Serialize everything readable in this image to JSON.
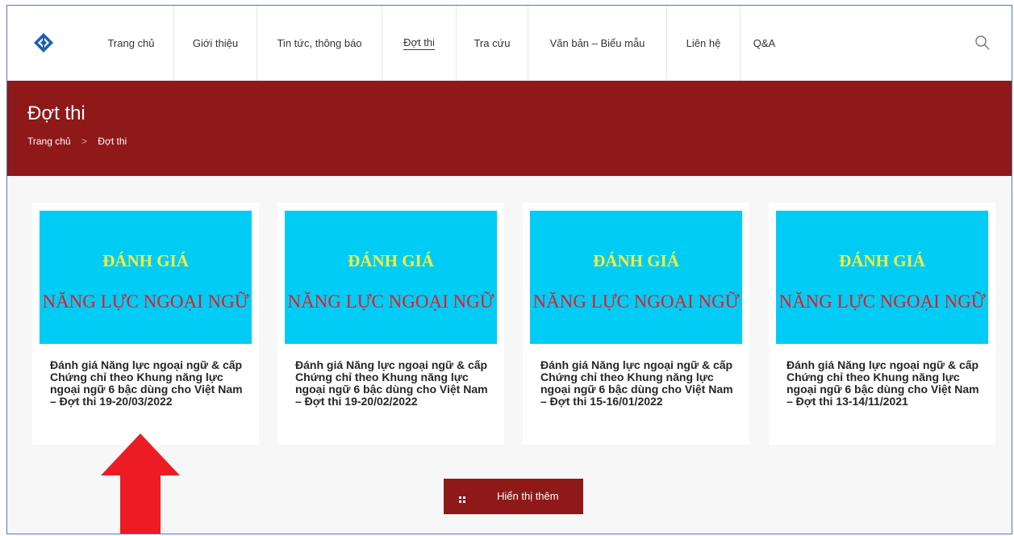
{
  "nav": {
    "items": [
      {
        "label": "Trang chủ"
      },
      {
        "label": "Giới thiệu"
      },
      {
        "label": "Tin tức, thông báo"
      },
      {
        "label": "Đợt thi"
      },
      {
        "label": "Tra cứu"
      },
      {
        "label": "Văn bản – Biểu mẫu"
      },
      {
        "label": "Liên hệ"
      },
      {
        "label": "Q&A"
      }
    ],
    "active_index": 3,
    "search_icon": "search-icon"
  },
  "banner": {
    "title": "Đợt thi",
    "breadcrumb": {
      "home": "Trang chủ",
      "separator": ">",
      "current": "Đợt thi"
    }
  },
  "cards": [
    {
      "thumb_line1": "ĐÁNH GIÁ",
      "thumb_line2": "NĂNG LỰC NGOẠI NGỮ",
      "title": "Đánh giá Năng lực ngoại ngữ & cấp Chứng chỉ theo Khung năng lực ngoại ngữ 6 bậc dùng cho Việt Nam – Đợt thi 19-20/03/2022"
    },
    {
      "thumb_line1": "ĐÁNH GIÁ",
      "thumb_line2": "NĂNG LỰC NGOẠI NGỮ",
      "title": "Đánh giá Năng lực ngoại ngữ & cấp Chứng chỉ theo Khung năng lực ngoại ngữ 6 bậc dùng cho Việt Nam – Đợt thi 19-20/02/2022"
    },
    {
      "thumb_line1": "ĐÁNH GIÁ",
      "thumb_line2": "NĂNG LỰC NGOẠI NGỮ",
      "title": "Đánh giá Năng lực ngoại ngữ & cấp Chứng chỉ theo Khung năng lực ngoại ngữ 6 bậc dùng cho Việt Nam – Đợt thi 15-16/01/2022"
    },
    {
      "thumb_line1": "ĐÁNH GIÁ",
      "thumb_line2": "NĂNG LỰC NGOẠI NGỮ",
      "title": "Đánh giá Năng lực ngoại ngữ & cấp Chứng chỉ theo Khung năng lực ngoại ngữ 6 bậc dùng cho Việt Nam – Đợt thi 13-14/11/2021"
    }
  ],
  "more_button": {
    "label": "Hiển thị thêm",
    "icon": "grid-icon"
  },
  "colors": {
    "brand_red": "#8f1919",
    "thumb_bg": "#00ccf5",
    "thumb_yellow": "#f5ee3a",
    "thumb_red": "#e11c25",
    "annotation_arrow": "#ed1c24",
    "frame_border": "#4a7bd4"
  }
}
